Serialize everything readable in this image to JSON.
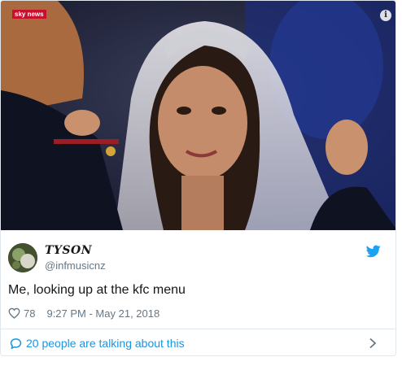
{
  "media": {
    "channel_logo": "sky news",
    "info_glyph": "i"
  },
  "author": {
    "name": "TYSON",
    "handle": "@infmusicnz",
    "avatar_icon": "avatar-photo"
  },
  "tweet": {
    "text": "Me, looking up at the kfc menu",
    "likes": "78",
    "timestamp": "9:27 PM - May 21, 2018"
  },
  "footer": {
    "talking_label": "20 people are talking about this"
  },
  "colors": {
    "twitter_blue": "#1b95e0",
    "text": "#14171a",
    "secondary": "#657786",
    "border": "#e1e8ed"
  }
}
